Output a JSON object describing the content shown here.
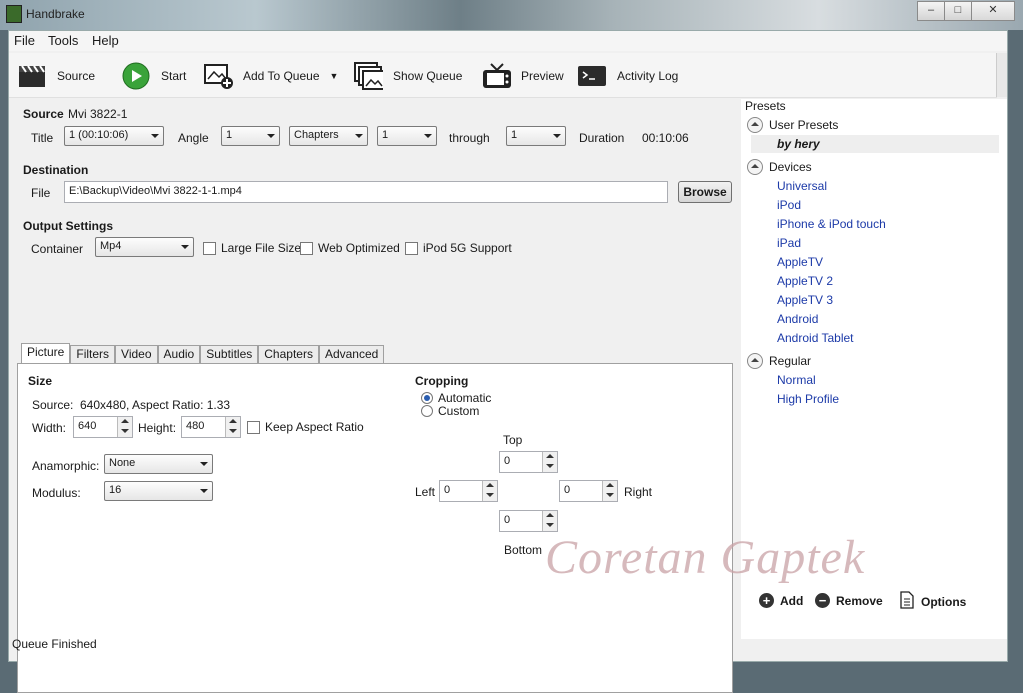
{
  "window": {
    "title": "Handbrake",
    "buttons": [
      "–",
      "□",
      "✕"
    ]
  },
  "menu": [
    "File",
    "Tools",
    "Help"
  ],
  "toolbar": {
    "source": "Source",
    "start": "Start",
    "add_to_queue": "Add To Queue",
    "show_queue": "Show Queue",
    "preview": "Preview",
    "activity_log": "Activity Log"
  },
  "source": {
    "label": "Source",
    "name": "Mvi 3822-1",
    "title_label": "Title",
    "title_value": "1 (00:10:06)",
    "angle_label": "Angle",
    "angle_value": "1",
    "range_mode": "Chapters",
    "range_start": "1",
    "through_label": "through",
    "range_end": "1",
    "duration_label": "Duration",
    "duration_value": "00:10:06"
  },
  "destination": {
    "label": "Destination",
    "file_label": "File",
    "file_value": "E:\\Backup\\Video\\Mvi 3822-1-1.mp4",
    "browse": "Browse"
  },
  "output": {
    "label": "Output Settings",
    "container_label": "Container",
    "container_value": "Mp4",
    "large_file": "Large File Size",
    "web_optimized": "Web Optimized",
    "ipod_5g": "iPod 5G Support"
  },
  "tabs": [
    "Picture",
    "Filters",
    "Video",
    "Audio",
    "Subtitles",
    "Chapters",
    "Advanced"
  ],
  "picture": {
    "size_label": "Size",
    "source_label": "Source:",
    "source_value": "640x480, Aspect Ratio: 1.33",
    "width_label": "Width:",
    "width_value": "640",
    "height_label": "Height:",
    "height_value": "480",
    "keep_aspect": "Keep Aspect Ratio",
    "anamorphic_label": "Anamorphic:",
    "anamorphic_value": "None",
    "modulus_label": "Modulus:",
    "modulus_value": "16",
    "cropping_label": "Cropping",
    "crop_automatic": "Automatic",
    "crop_custom": "Custom",
    "top_label": "Top",
    "top_value": "0",
    "left_label": "Left",
    "left_value": "0",
    "right_label": "Right",
    "right_value": "0",
    "bottom_label": "Bottom",
    "bottom_value": "0"
  },
  "presets": {
    "header": "Presets",
    "user_group": "User Presets",
    "user_items": [
      "by hery"
    ],
    "devices_group": "Devices",
    "device_items": [
      "Universal",
      "iPod",
      "iPhone & iPod touch",
      "iPad",
      "AppleTV",
      "AppleTV 2",
      "AppleTV 3",
      "Android",
      "Android Tablet"
    ],
    "regular_group": "Regular",
    "regular_items": [
      "Normal",
      "High Profile"
    ],
    "add": "Add",
    "remove": "Remove",
    "options": "Options"
  },
  "status": "Queue Finished",
  "watermark": "Coretan Gaptek",
  "colors": {
    "link": "#1c3aa8",
    "start_green": "#3aa33a"
  }
}
